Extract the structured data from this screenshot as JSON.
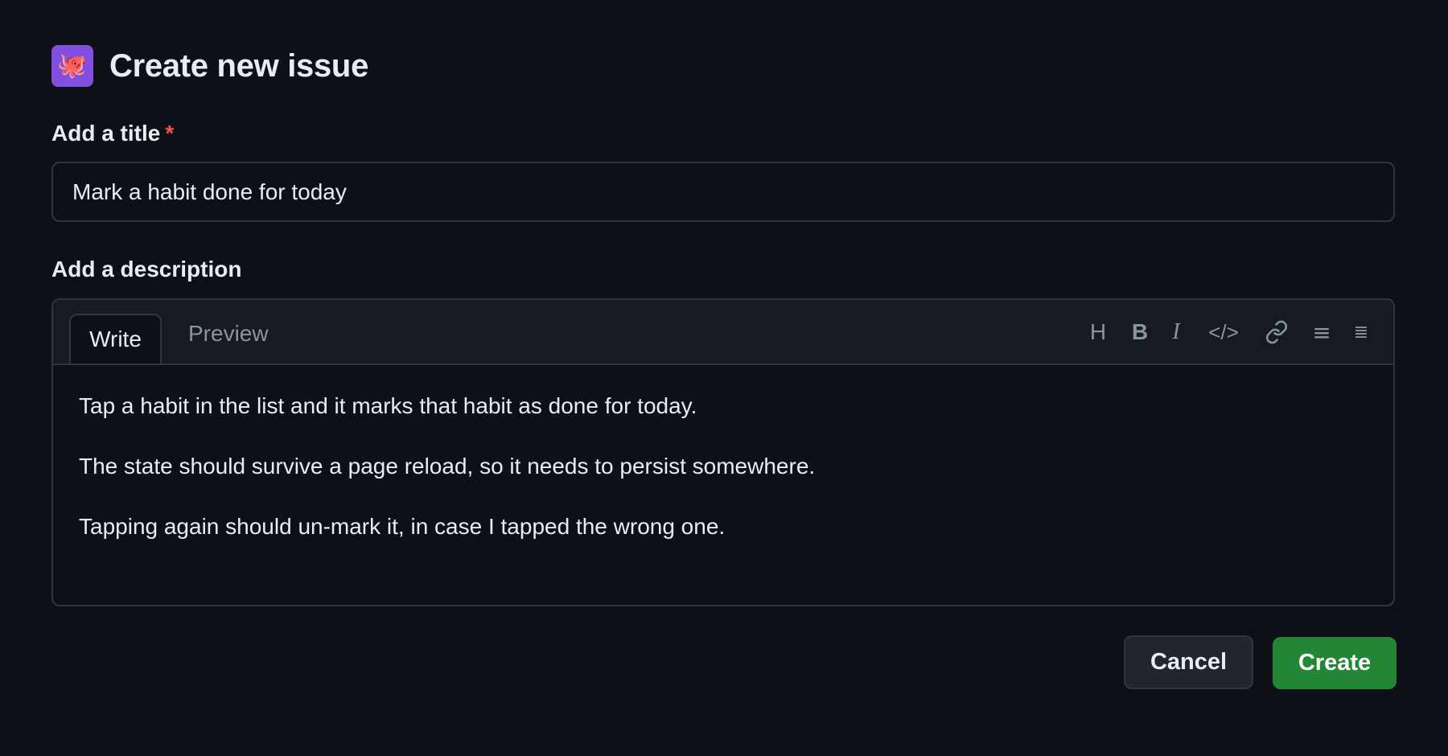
{
  "header": {
    "logo_emoji": "🐙",
    "logo_color": "#8250df",
    "title": "Create new issue"
  },
  "title_field": {
    "label": "Add a title",
    "required_marker": "*",
    "value": "Mark a habit done for today"
  },
  "description_field": {
    "label": "Add a description",
    "tabs": {
      "write": "Write",
      "preview": "Preview",
      "active": "write"
    },
    "toolbar": {
      "heading": "H",
      "bold": "B",
      "italic": "I",
      "code": "</>",
      "link_icon": "link-icon",
      "unordered_list": "≡",
      "ordered_list": "≣"
    },
    "paragraphs": [
      "Tap a habit in the list and it marks that habit as done for today.",
      "The state should survive a page reload, so it needs to persist somewhere.",
      "Tapping again should un-mark it, in case I tapped the wrong one."
    ]
  },
  "actions": {
    "cancel_label": "Cancel",
    "create_label": "Create",
    "create_color": "#238636"
  }
}
